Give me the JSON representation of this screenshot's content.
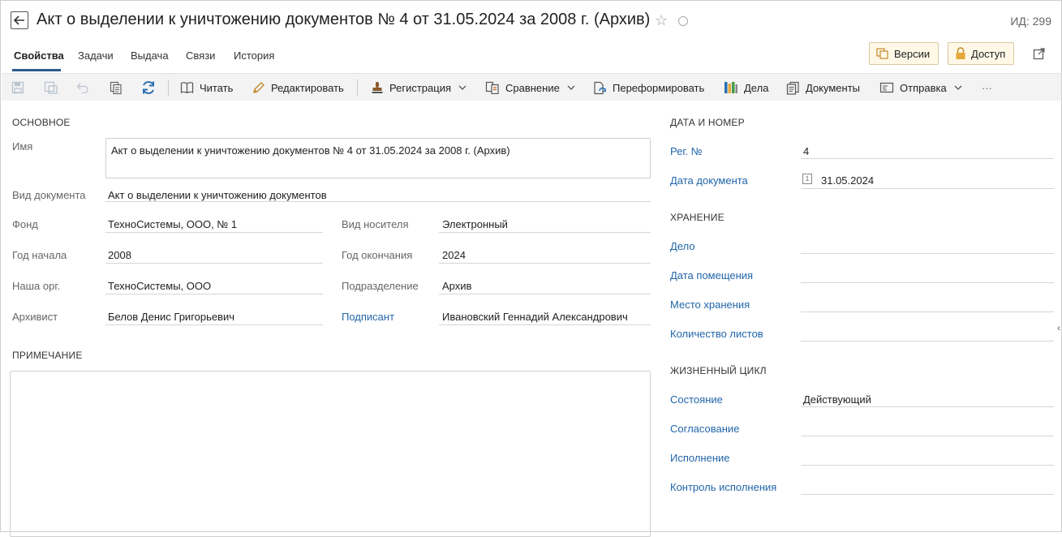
{
  "header": {
    "title": "Акт о выделении к уничтожению документов № 4 от 31.05.2024 за 2008 г. (Архив)",
    "id_label": "ИД: 299",
    "versions_label": "Версии",
    "access_label": "Доступ"
  },
  "tabs": [
    {
      "label": "Свойства",
      "active": true
    },
    {
      "label": "Задачи"
    },
    {
      "label": "Выдача"
    },
    {
      "label": "Связи"
    },
    {
      "label": "История"
    }
  ],
  "toolbar": {
    "read": "Читать",
    "edit": "Редактировать",
    "registration": "Регистрация",
    "compare": "Сравнение",
    "reform": "Переформировать",
    "cases": "Дела",
    "documents": "Документы",
    "send": "Отправка",
    "more": "···"
  },
  "main": {
    "section_title": "ОСНОВНОЕ",
    "name_label": "Имя",
    "name_value": "Акт о выделении к уничтожению документов № 4 от 31.05.2024 за 2008 г. (Архив)",
    "doc_type_label": "Вид документа",
    "doc_type_value": "Акт о выделении к уничтожению документов",
    "fund_label": "Фонд",
    "fund_value": "ТехноСистемы, ООО, № 1",
    "carrier_label": "Вид носителя",
    "carrier_value": "Электронный",
    "year_start_label": "Год начала",
    "year_start_value": "2008",
    "year_end_label": "Год окончания",
    "year_end_value": "2024",
    "org_label": "Наша орг.",
    "org_value": "ТехноСистемы, ООО",
    "dept_label": "Подразделение",
    "dept_value": "Архив",
    "archivist_label": "Архивист",
    "archivist_value": "Белов Денис Григорьевич",
    "signer_label": "Подписант",
    "signer_value": "Ивановский Геннадий Александрович",
    "note_title": "ПРИМЕЧАНИЕ"
  },
  "side": {
    "date_section": "ДАТА И НОМЕР",
    "reg_label": "Рег. №",
    "reg_value": "4",
    "date_label": "Дата документа",
    "date_value": "31.05.2024",
    "storage_section": "ХРАНЕНИЕ",
    "case_label": "Дело",
    "placement_label": "Дата помещения",
    "place_label": "Место хранения",
    "sheets_label": "Количество листов",
    "lifecycle_section": "ЖИЗНЕННЫЙ ЦИКЛ",
    "state_label": "Состояние",
    "state_value": "Действующий",
    "approval_label": "Согласование",
    "execution_label": "Исполнение",
    "control_label": "Контроль исполнения"
  },
  "colors": {
    "accent": "#2a5a8a",
    "link": "#2266aa",
    "header_button_bg": "#fff8e6",
    "toolbar_bg": "#f3f3f3"
  }
}
